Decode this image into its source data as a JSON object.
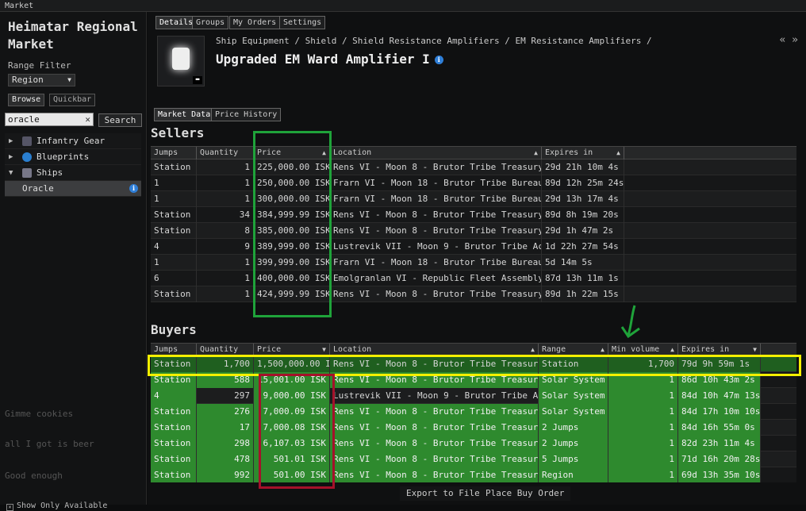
{
  "window_title": "Market",
  "left": {
    "region_title": "Heimatar Regional Market",
    "range_filter_label": "Range Filter",
    "range_value": "Region",
    "tabs": [
      "Browse",
      "Quickbar"
    ],
    "search_value": "oracle",
    "search_button": "Search",
    "tree": [
      {
        "label": "Infantry Gear",
        "expanded": false
      },
      {
        "label": "Blueprints",
        "expanded": false
      },
      {
        "label": "Ships",
        "expanded": true
      },
      {
        "label": "Oracle",
        "selected": true
      }
    ],
    "chat_lines": [
      "Gimme cookies",
      "all I got is beer",
      "Good enough"
    ],
    "show_only_available": "Show Only Available"
  },
  "main": {
    "tabs": [
      "Details",
      "Groups",
      "My Orders",
      "Settings"
    ],
    "breadcrumb": "Ship Equipment / Shield / Shield Resistance Amplifiers / EM Resistance Amplifiers /",
    "item_name": "Upgraded EM Ward Amplifier I",
    "market_tabs": [
      "Market Data",
      "Price History"
    ],
    "sellers_title": "Sellers",
    "buyers_title": "Buyers",
    "export_button": "Export to File",
    "place_buy_button": "Place Buy Order"
  },
  "sellers": {
    "columns": [
      "Jumps",
      "Quantity",
      "Price",
      "Location",
      "Expires in"
    ],
    "rows": [
      [
        "Station",
        "1",
        "225,000.00 ISK",
        "Rens VI - Moon 8 - Brutor Tribe Treasury",
        "29d 21h 10m 4s"
      ],
      [
        "1",
        "1",
        "250,000.00 ISK",
        "Frarn VI - Moon 18 - Brutor Tribe Bureau",
        "89d 12h 25m 24s"
      ],
      [
        "1",
        "1",
        "300,000.00 ISK",
        "Frarn VI - Moon 18 - Brutor Tribe Bureau",
        "29d 13h 17m 4s"
      ],
      [
        "Station",
        "34",
        "384,999.99 ISK",
        "Rens VI - Moon 8 - Brutor Tribe Treasury",
        "89d 8h 19m 20s"
      ],
      [
        "Station",
        "8",
        "385,000.00 ISK",
        "Rens VI - Moon 8 - Brutor Tribe Treasury",
        "29d 1h 47m 2s"
      ],
      [
        "4",
        "9",
        "389,999.00 ISK",
        "Lustrevik VII - Moon 9 - Brutor Tribe Academy",
        "1d 22h 27m 54s"
      ],
      [
        "1",
        "1",
        "399,999.00 ISK",
        "Frarn VI - Moon 18 - Brutor Tribe Bureau",
        "5d 14m 5s"
      ],
      [
        "6",
        "1",
        "400,000.00 ISK",
        "Emolgranlan VI - Republic Fleet Assembly Plant",
        "87d 13h 11m 1s"
      ],
      [
        "Station",
        "1",
        "424,999.99 ISK",
        "Rens VI - Moon 8 - Brutor Tribe Treasury",
        "89d 1h 22m 15s"
      ]
    ]
  },
  "buyers": {
    "columns": [
      "Jumps",
      "Quantity",
      "Price",
      "Location",
      "Range",
      "Min volume",
      "Expires in"
    ],
    "rows": [
      [
        "Station",
        "1,700",
        "1,500,000.00 ISK",
        "Rens VI - Moon 8 - Brutor Tribe Treasury",
        "Station",
        "1,700",
        "79d 9h 59m 1s"
      ],
      [
        "Station",
        "588",
        "15,001.00 ISK",
        "Rens VI - Moon 8 - Brutor Tribe Treasury",
        "Solar System",
        "1",
        "86d 10h 43m 2s"
      ],
      [
        "4",
        "297",
        "9,000.00 ISK",
        "Lustrevik VII - Moon 9 - Brutor Tribe Academy",
        "Solar System",
        "1",
        "84d 10h 47m 13s"
      ],
      [
        "Station",
        "276",
        "7,000.09 ISK",
        "Rens VI - Moon 8 - Brutor Tribe Treasury",
        "Solar System",
        "1",
        "84d 17h 10m 10s"
      ],
      [
        "Station",
        "17",
        "7,000.08 ISK",
        "Rens VI - Moon 8 - Brutor Tribe Treasury",
        "2 Jumps",
        "1",
        "84d 16h 55m 0s"
      ],
      [
        "Station",
        "298",
        "6,107.03 ISK",
        "Rens VI - Moon 8 - Brutor Tribe Treasury",
        "2 Jumps",
        "1",
        "82d 23h 11m 4s"
      ],
      [
        "Station",
        "478",
        "501.01 ISK",
        "Rens VI - Moon 8 - Brutor Tribe Treasury",
        "5 Jumps",
        "1",
        "71d 16h 20m 28s"
      ],
      [
        "Station",
        "992",
        "501.00 ISK",
        "Rens VI - Moon 8 - Brutor Tribe Treasury",
        "Region",
        "1",
        "69d 13h 35m 10s"
      ]
    ]
  },
  "colors": {
    "highlight_green": "#1fa33a",
    "highlight_yellow": "#f4f000",
    "highlight_red": "#a5112a",
    "row_green": "#2e8a2e"
  }
}
